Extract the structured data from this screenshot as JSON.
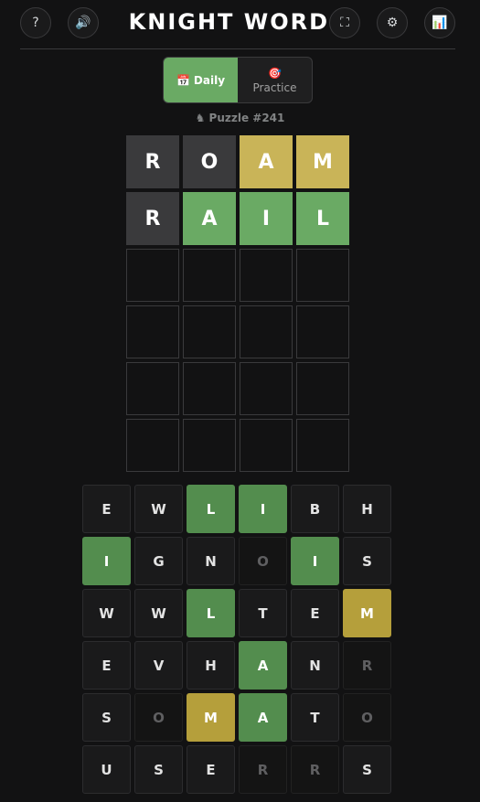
{
  "header": {
    "title": "KNIGHT WORDS",
    "icons": {
      "help": "?",
      "sound": "🔊",
      "fullscreen": "⛶",
      "settings": "⚙",
      "stats": "📊"
    }
  },
  "mode": {
    "daily_icon": "📅",
    "daily_label": "Daily",
    "practice_icon": "🎯",
    "practice_label": "Practice"
  },
  "puzzle_label": "♞ Puzzle #241",
  "board": {
    "rows": [
      [
        {
          "l": "R",
          "s": "absent"
        },
        {
          "l": "O",
          "s": "absent"
        },
        {
          "l": "A",
          "s": "present"
        },
        {
          "l": "M",
          "s": "present"
        }
      ],
      [
        {
          "l": "R",
          "s": "absent"
        },
        {
          "l": "A",
          "s": "correct"
        },
        {
          "l": "I",
          "s": "correct"
        },
        {
          "l": "L",
          "s": "correct"
        }
      ],
      [
        {
          "l": "",
          "s": "empty"
        },
        {
          "l": "",
          "s": "empty"
        },
        {
          "l": "",
          "s": "empty"
        },
        {
          "l": "",
          "s": "empty"
        }
      ],
      [
        {
          "l": "",
          "s": "empty"
        },
        {
          "l": "",
          "s": "empty"
        },
        {
          "l": "",
          "s": "empty"
        },
        {
          "l": "",
          "s": "empty"
        }
      ],
      [
        {
          "l": "",
          "s": "empty"
        },
        {
          "l": "",
          "s": "empty"
        },
        {
          "l": "",
          "s": "empty"
        },
        {
          "l": "",
          "s": "empty"
        }
      ],
      [
        {
          "l": "",
          "s": "empty"
        },
        {
          "l": "",
          "s": "empty"
        },
        {
          "l": "",
          "s": "empty"
        },
        {
          "l": "",
          "s": "empty"
        }
      ]
    ]
  },
  "letter_grid": {
    "rows": [
      [
        {
          "l": "E",
          "s": "normal"
        },
        {
          "l": "W",
          "s": "normal"
        },
        {
          "l": "L",
          "s": "correct"
        },
        {
          "l": "I",
          "s": "correct"
        },
        {
          "l": "B",
          "s": "normal"
        },
        {
          "l": "H",
          "s": "normal"
        }
      ],
      [
        {
          "l": "I",
          "s": "correct"
        },
        {
          "l": "G",
          "s": "normal"
        },
        {
          "l": "N",
          "s": "normal"
        },
        {
          "l": "O",
          "s": "absent"
        },
        {
          "l": "I",
          "s": "correct"
        },
        {
          "l": "S",
          "s": "normal"
        }
      ],
      [
        {
          "l": "W",
          "s": "normal"
        },
        {
          "l": "W",
          "s": "normal"
        },
        {
          "l": "L",
          "s": "correct"
        },
        {
          "l": "T",
          "s": "normal"
        },
        {
          "l": "E",
          "s": "normal"
        },
        {
          "l": "M",
          "s": "present"
        }
      ],
      [
        {
          "l": "E",
          "s": "normal"
        },
        {
          "l": "V",
          "s": "normal"
        },
        {
          "l": "H",
          "s": "normal"
        },
        {
          "l": "A",
          "s": "correct"
        },
        {
          "l": "N",
          "s": "normal"
        },
        {
          "l": "R",
          "s": "absent"
        }
      ],
      [
        {
          "l": "S",
          "s": "normal"
        },
        {
          "l": "O",
          "s": "absent"
        },
        {
          "l": "M",
          "s": "present"
        },
        {
          "l": "A",
          "s": "correct"
        },
        {
          "l": "T",
          "s": "normal"
        },
        {
          "l": "O",
          "s": "absent"
        }
      ],
      [
        {
          "l": "U",
          "s": "normal"
        },
        {
          "l": "S",
          "s": "normal"
        },
        {
          "l": "E",
          "s": "normal"
        },
        {
          "l": "R",
          "s": "absent"
        },
        {
          "l": "R",
          "s": "absent"
        },
        {
          "l": "S",
          "s": "normal"
        }
      ]
    ]
  },
  "colors": {
    "correct": "#6aaa64",
    "present": "#c9b458",
    "absent": "#3a3a3c"
  }
}
